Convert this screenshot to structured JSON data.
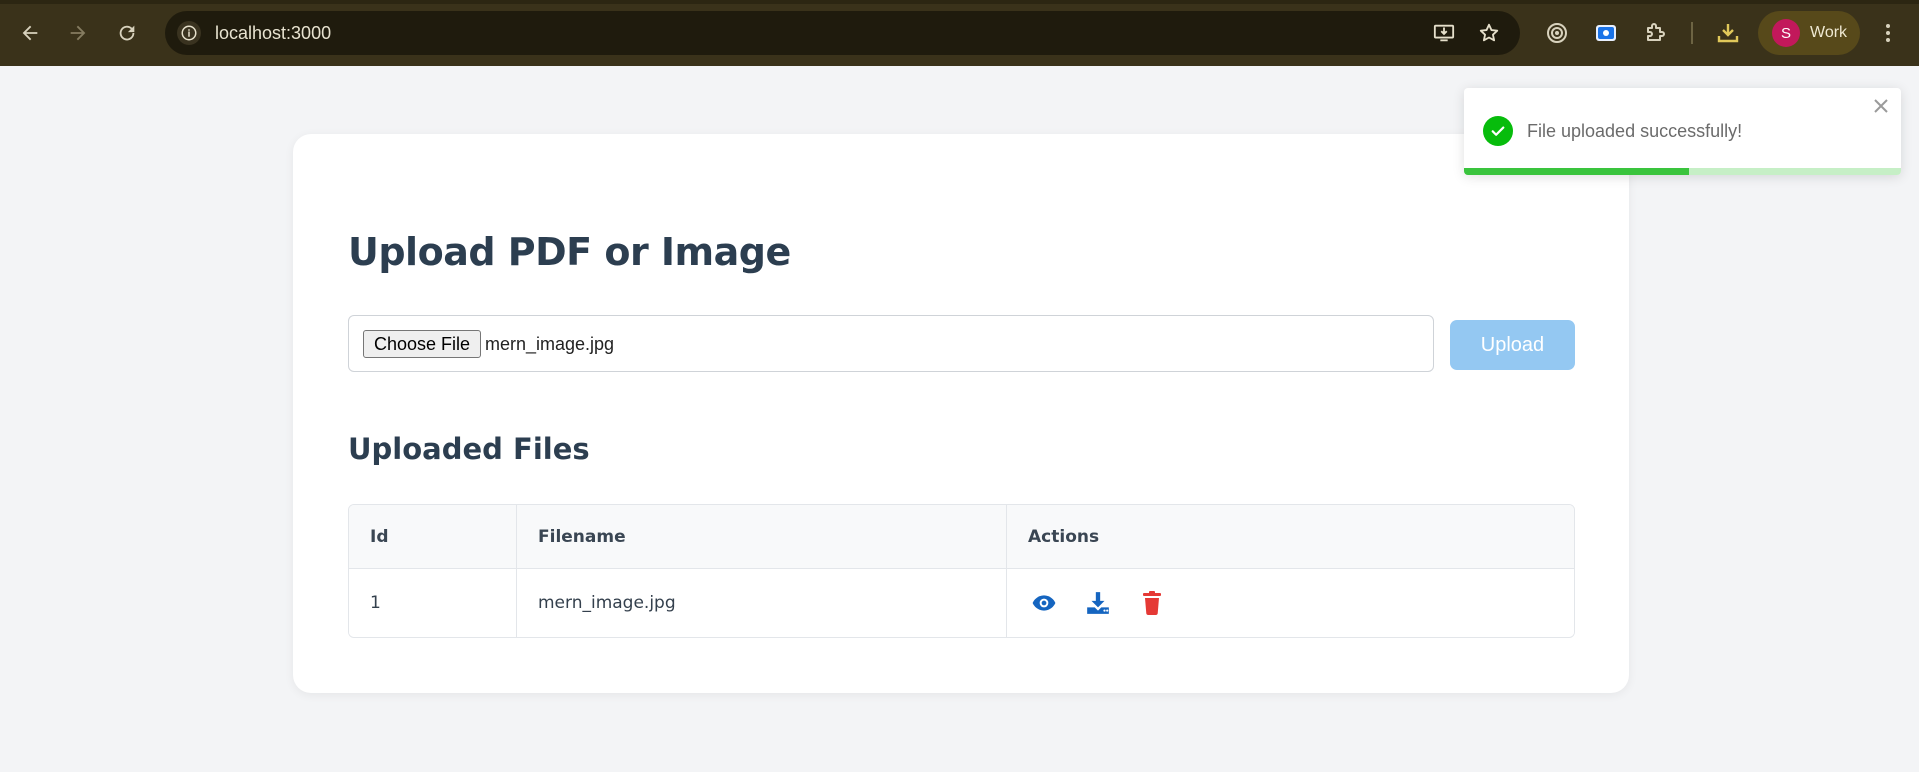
{
  "browser": {
    "url": "localhost:3000",
    "profile_initial": "S",
    "profile_label": "Work",
    "icons": [
      "back-icon",
      "forward-icon",
      "reload-icon",
      "site-info-icon",
      "install-app-icon",
      "bookmark-star-icon",
      "extension-target-icon",
      "extension-screen-icon",
      "extensions-puzzle-icon",
      "downloads-icon"
    ]
  },
  "page": {
    "title": "Upload PDF or Image",
    "choose_file_label": "Choose File",
    "selected_file": "mern_image.jpg",
    "upload_label": "Upload",
    "files_heading": "Uploaded Files",
    "table": {
      "headers": [
        "Id",
        "Filename",
        "Actions"
      ],
      "rows": [
        {
          "id": "1",
          "filename": "mern_image.jpg",
          "actions": [
            "view-icon",
            "download-icon",
            "delete-icon"
          ]
        }
      ]
    }
  },
  "toast": {
    "message": "File uploaded successfully!",
    "progress": 0.515,
    "status_color": "#07bc0c"
  },
  "colors": {
    "heading": "#2c3e50",
    "upload_button": "#94c8f2",
    "action_blue": "#1565c0",
    "action_red": "#e53935"
  }
}
